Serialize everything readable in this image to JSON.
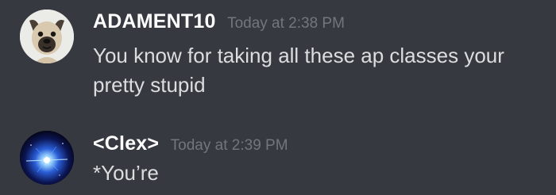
{
  "messages": [
    {
      "username": "ADAMENT10",
      "timestamp": "Today at 2:38 PM",
      "text_line1": "You know for taking all these ap classes your",
      "text_line2": "pretty stupid",
      "avatar_icon": "pug-dog-avatar-icon"
    },
    {
      "username": "<Clex>",
      "timestamp": "Today at 2:39 PM",
      "text_line1": "*You’re",
      "avatar_icon": "blue-galaxy-avatar-icon"
    }
  ],
  "colors": {
    "background": "#36393f",
    "username": "#ffffff",
    "timestamp": "#72767d",
    "message_text": "#dcddde"
  }
}
